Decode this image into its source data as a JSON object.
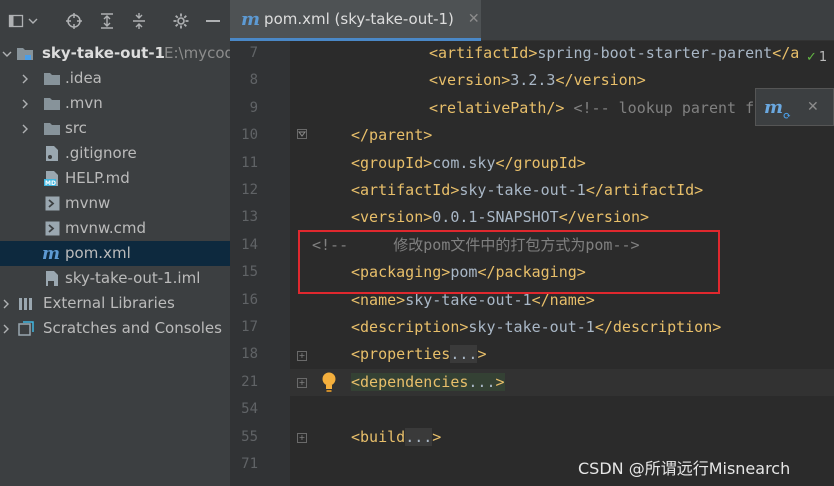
{
  "project": {
    "toolbar_icons": [
      "project-view-icon",
      "chevron-down-icon",
      "locate-icon",
      "expand-all-icon",
      "collapse-all-icon",
      "settings-icon",
      "minimize-icon"
    ],
    "root": {
      "name": "sky-take-out-1",
      "path": "E:\\mycod"
    },
    "items": [
      {
        "label": ".idea",
        "icon": "folder-icon"
      },
      {
        "label": ".mvn",
        "icon": "folder-icon"
      },
      {
        "label": "src",
        "icon": "folder-icon"
      },
      {
        "label": ".gitignore",
        "icon": "gitignore-file-icon"
      },
      {
        "label": "HELP.md",
        "icon": "markdown-file-icon"
      },
      {
        "label": "mvnw",
        "icon": "shell-file-icon"
      },
      {
        "label": "mvnw.cmd",
        "icon": "cmd-file-icon"
      },
      {
        "label": "pom.xml",
        "icon": "maven-file-icon"
      },
      {
        "label": "sky-take-out-1.iml",
        "icon": "iml-file-icon"
      }
    ],
    "external_libraries": "External Libraries",
    "scratches": "Scratches and Consoles"
  },
  "editor": {
    "tab": {
      "icon": "m",
      "title": "pom.xml (sky-take-out-1)",
      "close": "✕"
    },
    "inspection": {
      "icon": "check-icon",
      "count": "1"
    },
    "maven_popup": {
      "icon": "m",
      "close": "✕"
    },
    "lines": [
      {
        "num": "7",
        "indent": 3,
        "segs": [
          [
            "tag",
            "<artifactId>"
          ],
          [
            "text",
            "spring-boot-starter-parent"
          ],
          [
            "tag",
            "</a"
          ]
        ]
      },
      {
        "num": "8",
        "indent": 3,
        "segs": [
          [
            "tag",
            "<version>"
          ],
          [
            "text",
            "3.2.3"
          ],
          [
            "tag",
            "</version>"
          ]
        ]
      },
      {
        "num": "9",
        "indent": 3,
        "segs": [
          [
            "tag",
            "<relativePath/>"
          ],
          [
            "text",
            " "
          ],
          [
            "comment",
            "<!-- lookup parent from"
          ]
        ]
      },
      {
        "num": "10",
        "indent": 1,
        "segs": [
          [
            "tag",
            "</parent>"
          ]
        ]
      },
      {
        "num": "11",
        "indent": 1,
        "segs": [
          [
            "tag",
            "<groupId>"
          ],
          [
            "text",
            "com.sky"
          ],
          [
            "tag",
            "</groupId>"
          ]
        ]
      },
      {
        "num": "12",
        "indent": 1,
        "segs": [
          [
            "tag",
            "<artifactId>"
          ],
          [
            "text",
            "sky-take-out-1"
          ],
          [
            "tag",
            "</artifactId>"
          ]
        ]
      },
      {
        "num": "13",
        "indent": 1,
        "segs": [
          [
            "tag",
            "<version>"
          ],
          [
            "text",
            "0.0.1-SNAPSHOT"
          ],
          [
            "tag",
            "</version>"
          ]
        ]
      },
      {
        "num": "14",
        "indent": 0,
        "segs": [
          [
            "comment",
            "<!--     修改pom文件中的打包方式为pom-->"
          ]
        ]
      },
      {
        "num": "15",
        "indent": 1,
        "segs": [
          [
            "tag",
            "<packaging>"
          ],
          [
            "text",
            "pom"
          ],
          [
            "tag",
            "</packaging>"
          ]
        ]
      },
      {
        "num": "16",
        "indent": 1,
        "segs": [
          [
            "tag",
            "<name>"
          ],
          [
            "text",
            "sky-take-out-1"
          ],
          [
            "tag",
            "</name>"
          ]
        ]
      },
      {
        "num": "17",
        "indent": 1,
        "segs": [
          [
            "tag",
            "<description>"
          ],
          [
            "text",
            "sky-take-out-1"
          ],
          [
            "tag",
            "</description>"
          ]
        ]
      },
      {
        "num": "18",
        "indent": 1,
        "segs": [
          [
            "tag",
            "<properties"
          ],
          [
            "fold",
            "..."
          ],
          [
            "tag",
            ">"
          ]
        ]
      },
      {
        "num": "21",
        "indent": 1,
        "segs": [
          [
            "hltag",
            "<dependencies"
          ],
          [
            "hlfold",
            "..."
          ],
          [
            "hltag",
            ">"
          ]
        ]
      },
      {
        "num": "54",
        "indent": 1,
        "segs": []
      },
      {
        "num": "55",
        "indent": 1,
        "segs": [
          [
            "tag",
            "<build"
          ],
          [
            "fold",
            "..."
          ],
          [
            "tag",
            ">"
          ]
        ]
      },
      {
        "num": "71",
        "indent": 1,
        "segs": []
      }
    ]
  },
  "watermark": "CSDN @所谓远行Misnearch"
}
